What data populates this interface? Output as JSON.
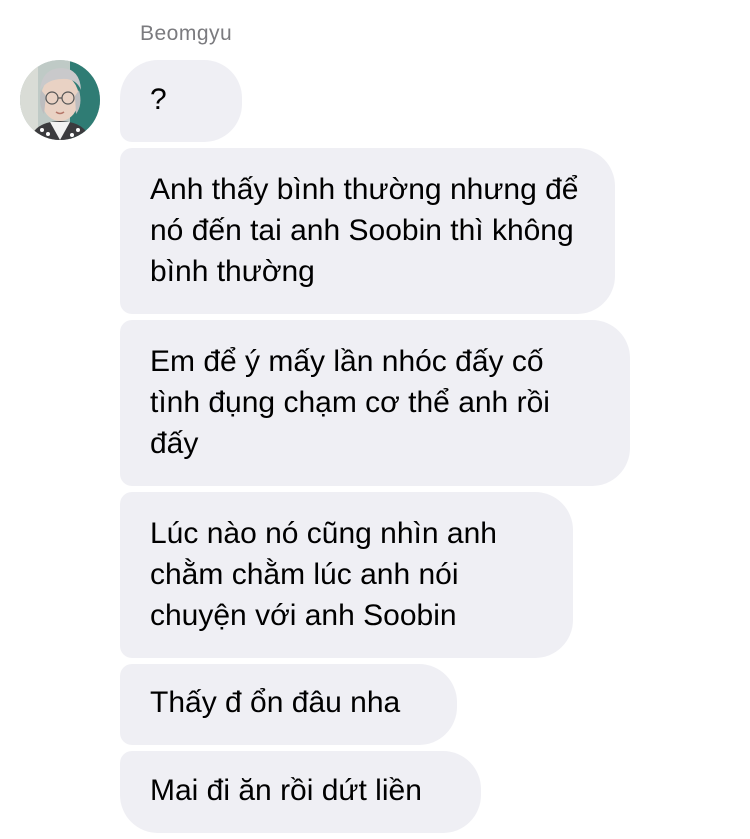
{
  "conversation": {
    "sender_name": "Beomgyu",
    "avatar_icon": "profile-photo-avatar",
    "bubble_color": "#efeff4",
    "messages": [
      {
        "text": "?"
      },
      {
        "text": "Anh thấy bình thường nhưng để nó đến tai anh Soobin thì không bình thường"
      },
      {
        "text": "Em để ý mấy lần nhóc đấy cố tình đụng chạm cơ thể anh rồi đấy"
      },
      {
        "text": "Lúc nào nó cũng nhìn anh chằm chằm lúc anh nói chuyện với anh Soobin"
      },
      {
        "text": "Thấy đ ổn đâu nha"
      },
      {
        "text": "Mai đi ăn rồi dứt liền"
      }
    ]
  }
}
